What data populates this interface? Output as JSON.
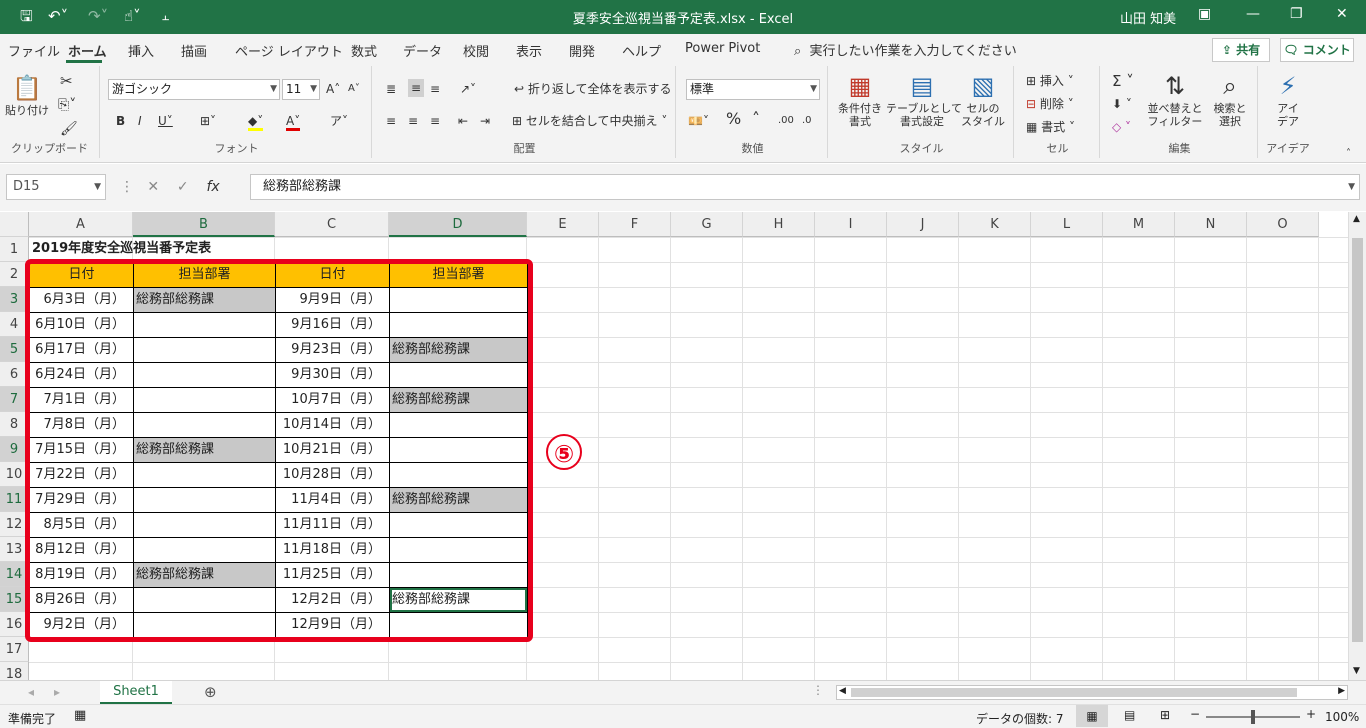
{
  "title": "夏季安全巡視当番予定表.xlsx  -  Excel",
  "user": "山田 知美",
  "tabs": [
    "ファイル",
    "ホーム",
    "挿入",
    "描画",
    "ページ レイアウト",
    "数式",
    "データ",
    "校閲",
    "表示",
    "開発",
    "ヘルプ",
    "Power Pivot"
  ],
  "tellme": "実行したい作業を入力してください",
  "share": "共有",
  "comment": "コメント",
  "ribbon": {
    "clipboard": {
      "label": "クリップボード",
      "paste": "貼り付け"
    },
    "font": {
      "label": "フォント",
      "name": "游ゴシック",
      "size": "11"
    },
    "align": {
      "label": "配置",
      "wrap": "折り返して全体を表示する",
      "merge": "セルを結合して中央揃え"
    },
    "number": {
      "label": "数値",
      "format": "標準"
    },
    "styles": {
      "label": "スタイル",
      "cond": "条件付き\n書式",
      "table": "テーブルとして\n書式設定",
      "cellstyle": "セルの\nスタイル"
    },
    "cells": {
      "label": "セル",
      "insert": "挿入",
      "delete": "削除",
      "format": "書式"
    },
    "edit": {
      "label": "編集",
      "sort": "並べ替えと\nフィルター",
      "find": "検索と\n選択"
    },
    "ideas": {
      "label": "アイデア",
      "btn": "アイ\nデア"
    }
  },
  "namebox": "D15",
  "formula": "総務部総務課",
  "columns": [
    "A",
    "B",
    "C",
    "D",
    "E",
    "F",
    "G",
    "H",
    "I",
    "J",
    "K",
    "L",
    "M",
    "N",
    "O"
  ],
  "sheet": {
    "title": "2019年度安全巡視当番予定表",
    "headers": [
      "日付",
      "担当部署",
      "日付",
      "担当部署"
    ],
    "rows": [
      [
        "6月3日（月）",
        "総務部総務課",
        "9月9日（月）",
        ""
      ],
      [
        "6月10日（月）",
        "",
        "9月16日（月）",
        ""
      ],
      [
        "6月17日（月）",
        "",
        "9月23日（月）",
        "総務部総務課"
      ],
      [
        "6月24日（月）",
        "",
        "9月30日（月）",
        ""
      ],
      [
        "7月1日（月）",
        "",
        "10月7日（月）",
        "総務部総務課"
      ],
      [
        "7月8日（月）",
        "",
        "10月14日（月）",
        ""
      ],
      [
        "7月15日（月）",
        "総務部総務課",
        "10月21日（月）",
        ""
      ],
      [
        "7月22日（月）",
        "",
        "10月28日（月）",
        ""
      ],
      [
        "7月29日（月）",
        "",
        "11月4日（月）",
        "総務部総務課"
      ],
      [
        "8月5日（月）",
        "",
        "11月11日（月）",
        ""
      ],
      [
        "8月12日（月）",
        "",
        "11月18日（月）",
        ""
      ],
      [
        "8月19日（月）",
        "総務部総務課",
        "11月25日（月）",
        ""
      ],
      [
        "8月26日（月）",
        "",
        "12月2日（月）",
        "総務部総務課"
      ],
      [
        "9月2日（月）",
        "",
        "12月9日（月）",
        ""
      ]
    ]
  },
  "marker": "⑤",
  "sheet_tab": "Sheet1",
  "status": {
    "ready": "準備完了",
    "count": "データの個数: 7",
    "zoom": "100%"
  },
  "colors": {
    "excel_green": "#217346",
    "header_fill": "#ffc000",
    "highlight": "#e8001c"
  }
}
